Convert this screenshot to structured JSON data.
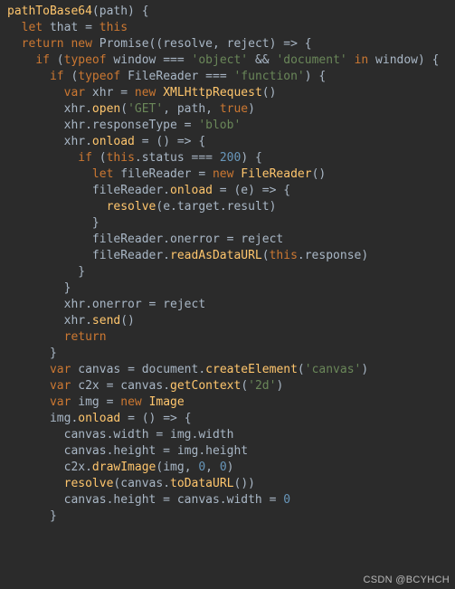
{
  "watermark": "CSDN @BCYHCH",
  "code": {
    "tokens": [
      [
        [
          "name",
          "pathToBase64"
        ],
        [
          "id",
          "(path) {"
        ]
      ],
      [
        [
          "id",
          "  "
        ],
        [
          "kw",
          "let"
        ],
        [
          "id",
          " that = "
        ],
        [
          "kw",
          "this"
        ]
      ],
      [
        [
          "id",
          "  "
        ],
        [
          "kw",
          "return new"
        ],
        [
          "id",
          " Promise((resolve"
        ],
        [
          "id",
          ", "
        ],
        [
          "id",
          "reject) => {"
        ]
      ],
      [
        [
          "id",
          "    "
        ],
        [
          "kw",
          "if"
        ],
        [
          "id",
          " ("
        ],
        [
          "kw",
          "typeof"
        ],
        [
          "id",
          " window === "
        ],
        [
          "str",
          "'object'"
        ],
        [
          "id",
          " && "
        ],
        [
          "str",
          "'document'"
        ],
        [
          "id",
          " "
        ],
        [
          "kw",
          "in"
        ],
        [
          "id",
          " window) {"
        ]
      ],
      [
        [
          "id",
          "      "
        ],
        [
          "kw",
          "if"
        ],
        [
          "id",
          " ("
        ],
        [
          "kw",
          "typeof"
        ],
        [
          "id",
          " FileReader === "
        ],
        [
          "str",
          "'function'"
        ],
        [
          "id",
          ") {"
        ]
      ],
      [
        [
          "id",
          "        "
        ],
        [
          "kw",
          "var"
        ],
        [
          "id",
          " xhr = "
        ],
        [
          "kw",
          "new"
        ],
        [
          "id",
          " "
        ],
        [
          "name",
          "XMLHttpRequest"
        ],
        [
          "id",
          "()"
        ]
      ],
      [
        [
          "id",
          "        xhr."
        ],
        [
          "name",
          "open"
        ],
        [
          "id",
          "("
        ],
        [
          "str",
          "'GET'"
        ],
        [
          "id",
          ", path"
        ],
        [
          "id",
          ", "
        ],
        [
          "bool",
          "true"
        ],
        [
          "id",
          ")"
        ]
      ],
      [
        [
          "id",
          "        xhr.responseType = "
        ],
        [
          "str",
          "'blob'"
        ]
      ],
      [
        [
          "id",
          "        xhr."
        ],
        [
          "name",
          "onload"
        ],
        [
          "id",
          " = () => {"
        ]
      ],
      [
        [
          "id",
          "          "
        ],
        [
          "kw",
          "if"
        ],
        [
          "id",
          " ("
        ],
        [
          "kw",
          "this"
        ],
        [
          "id",
          ".status === "
        ],
        [
          "num",
          "200"
        ],
        [
          "id",
          ") {"
        ]
      ],
      [
        [
          "id",
          "            "
        ],
        [
          "kw",
          "let"
        ],
        [
          "id",
          " fileReader = "
        ],
        [
          "kw",
          "new"
        ],
        [
          "id",
          " "
        ],
        [
          "name",
          "FileReader"
        ],
        [
          "id",
          "()"
        ]
      ],
      [
        [
          "id",
          "            fileReader."
        ],
        [
          "name",
          "onload"
        ],
        [
          "id",
          " = (e) => {"
        ]
      ],
      [
        [
          "id",
          "              "
        ],
        [
          "name",
          "resolve"
        ],
        [
          "id",
          "(e.target.result)"
        ]
      ],
      [
        [
          "id",
          "            }"
        ]
      ],
      [
        [
          "id",
          "            fileReader.onerror = reject"
        ]
      ],
      [
        [
          "id",
          "            fileReader."
        ],
        [
          "name",
          "readAsDataURL"
        ],
        [
          "id",
          "("
        ],
        [
          "kw",
          "this"
        ],
        [
          "id",
          ".response)"
        ]
      ],
      [
        [
          "id",
          "          }"
        ]
      ],
      [
        [
          "id",
          "        }"
        ]
      ],
      [
        [
          "id",
          "        xhr.onerror = reject"
        ]
      ],
      [
        [
          "id",
          "        xhr."
        ],
        [
          "name",
          "send"
        ],
        [
          "id",
          "()"
        ]
      ],
      [
        [
          "id",
          "        "
        ],
        [
          "kw",
          "return"
        ]
      ],
      [
        [
          "id",
          "      }"
        ]
      ],
      [
        [
          "id",
          "      "
        ],
        [
          "kw",
          "var"
        ],
        [
          "id",
          " canvas = document."
        ],
        [
          "name",
          "createElement"
        ],
        [
          "id",
          "("
        ],
        [
          "str",
          "'canvas'"
        ],
        [
          "id",
          ")"
        ]
      ],
      [
        [
          "id",
          "      "
        ],
        [
          "kw",
          "var"
        ],
        [
          "id",
          " c2x = canvas."
        ],
        [
          "name",
          "getContext"
        ],
        [
          "id",
          "("
        ],
        [
          "str",
          "'2d'"
        ],
        [
          "id",
          ")"
        ]
      ],
      [
        [
          "id",
          "      "
        ],
        [
          "kw",
          "var"
        ],
        [
          "id",
          " img = "
        ],
        [
          "kw",
          "new"
        ],
        [
          "id",
          " "
        ],
        [
          "name",
          "Image"
        ]
      ],
      [
        [
          "id",
          "      img."
        ],
        [
          "name",
          "onload"
        ],
        [
          "id",
          " = () => {"
        ]
      ],
      [
        [
          "id",
          "        canvas.width = img.width"
        ]
      ],
      [
        [
          "id",
          "        canvas.height = img.height"
        ]
      ],
      [
        [
          "id",
          "        c2x."
        ],
        [
          "name",
          "drawImage"
        ],
        [
          "id",
          "(img"
        ],
        [
          "id",
          ", "
        ],
        [
          "num",
          "0"
        ],
        [
          "id",
          ", "
        ],
        [
          "num",
          "0"
        ],
        [
          "id",
          ")"
        ]
      ],
      [
        [
          "id",
          "        "
        ],
        [
          "name",
          "resolve"
        ],
        [
          "id",
          "(canvas."
        ],
        [
          "name",
          "toDataURL"
        ],
        [
          "id",
          "())"
        ]
      ],
      [
        [
          "id",
          "        canvas.height = canvas.width = "
        ],
        [
          "num",
          "0"
        ]
      ],
      [
        [
          "id",
          "      }"
        ]
      ]
    ]
  }
}
